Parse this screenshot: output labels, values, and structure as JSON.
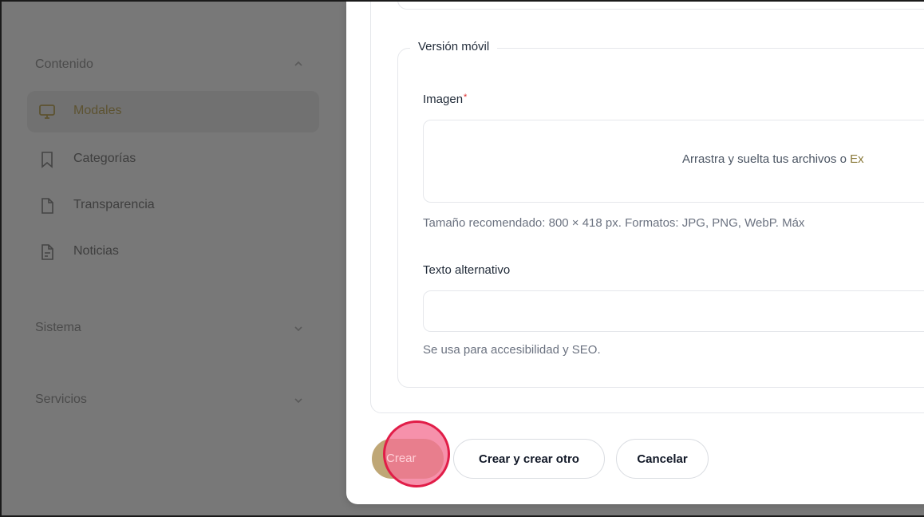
{
  "sidebar": {
    "sections": [
      {
        "title": "Contenido",
        "expanded": true
      },
      {
        "title": "Sistema",
        "expanded": false
      },
      {
        "title": "Servicios",
        "expanded": false
      }
    ],
    "items": [
      {
        "label": "Modales",
        "icon": "monitor-icon",
        "active": true
      },
      {
        "label": "Categorías",
        "icon": "bookmark-icon",
        "active": false
      },
      {
        "label": "Transparencia",
        "icon": "file-icon",
        "active": false
      },
      {
        "label": "Noticias",
        "icon": "file-text-icon",
        "active": false
      }
    ]
  },
  "form": {
    "fieldset_legend": "Versión móvil",
    "image": {
      "label": "Imagen",
      "required_mark": "*",
      "dropzone_text": "Arrastra y suelta tus archivos o ",
      "dropzone_link": "Ex",
      "helper": "Tamaño recomendado: 800 × 418 px. Formatos: JPG, PNG, WebP. Máx"
    },
    "alt_text": {
      "label": "Texto alternativo",
      "value": "",
      "helper": "Se usa para accesibilidad y SEO."
    }
  },
  "actions": {
    "create": "Crear",
    "create_another": "Crear y crear otro",
    "cancel": "Cancelar"
  },
  "colors": {
    "overlay": "#787878",
    "accent": "#bfa776",
    "required": "#dc2626",
    "link": "#8a7a3a",
    "click_indicator": "#e11d48"
  }
}
